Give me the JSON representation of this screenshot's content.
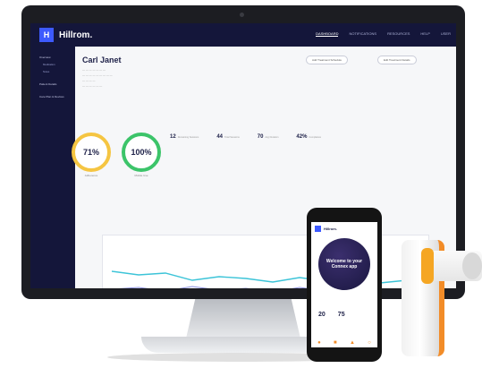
{
  "app": {
    "logo_mark": "H",
    "logo_text": "Hillrom."
  },
  "nav": [
    "DASHBOARD",
    "NOTIFICATIONS",
    "RESOURCES",
    "HELP",
    "USER"
  ],
  "sidebar": [
    "Overview",
    "Medication",
    "Notes",
    "Patient Details",
    "Care Plan & Devices"
  ],
  "patient": {
    "name": "Carl Janet",
    "btn1": "Add Treatment Schedule",
    "btn2": "Edit Treatment Details"
  },
  "rings": [
    {
      "value": "71%",
      "label": "Adherence"
    },
    {
      "value": "100%",
      "label": "Mobile Use"
    }
  ],
  "stats": [
    {
      "v": "12",
      "l": "Remaining Sessions"
    },
    {
      "v": "44",
      "l": "Total Sessions"
    },
    {
      "v": "70",
      "l": "Avg Duration"
    },
    {
      "v": "42%",
      "l": "Compliance"
    }
  ],
  "phone": {
    "title": "Hillrom.",
    "welcome": "Welcome to your Connex app",
    "stat1": "20",
    "stat2": "75",
    "nav": [
      "●",
      "■",
      "▲",
      "○"
    ]
  }
}
